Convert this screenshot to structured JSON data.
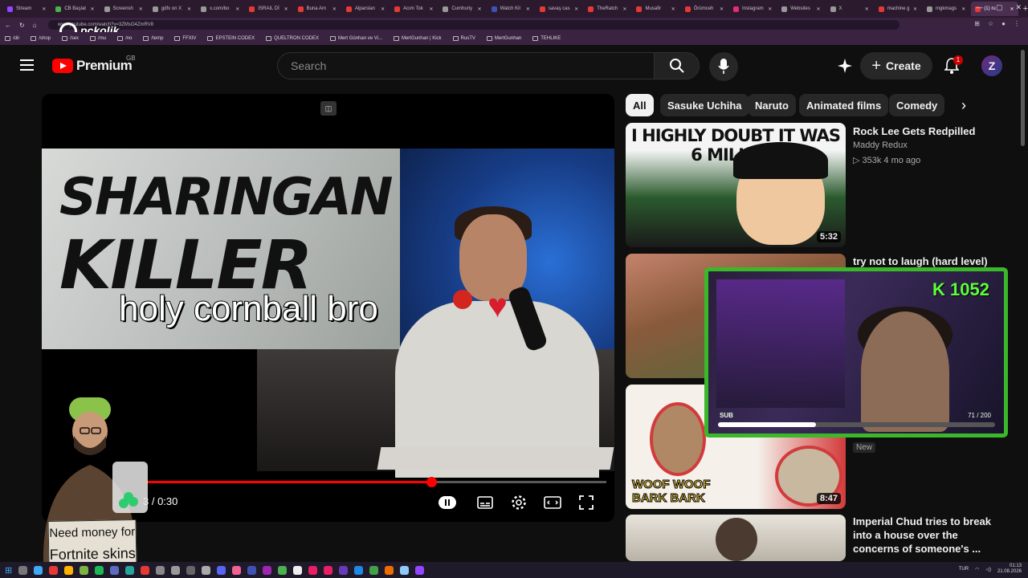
{
  "browser": {
    "tabs": [
      {
        "label": "Stream",
        "color": "#9146ff"
      },
      {
        "label": "CB Başlat",
        "color": "#4caf50"
      },
      {
        "label": "Screensh",
        "color": "#999999"
      },
      {
        "label": "gdfx on X",
        "color": "#999999"
      },
      {
        "label": "x.com/bo",
        "color": "#999999"
      },
      {
        "label": "ISRAIL Dİ",
        "color": "#e53935"
      },
      {
        "label": "Buna Am",
        "color": "#e53935"
      },
      {
        "label": "Alparslan",
        "color": "#e53935"
      },
      {
        "label": "Acım Tok",
        "color": "#e53935"
      },
      {
        "label": "Cumhuriy",
        "color": "#999999"
      },
      {
        "label": "Watch Kil",
        "color": "#3f51b5"
      },
      {
        "label": "savaş cas",
        "color": "#e53935"
      },
      {
        "label": "TheRatch",
        "color": "#e53935"
      },
      {
        "label": "Musafir",
        "color": "#e53935"
      },
      {
        "label": "Örümceh",
        "color": "#e53935"
      },
      {
        "label": "Instagram",
        "color": "#e1306c"
      },
      {
        "label": "Websites",
        "color": "#999999"
      },
      {
        "label": "X",
        "color": "#999999"
      },
      {
        "label": "machine g",
        "color": "#e53935"
      },
      {
        "label": "mgkmags",
        "color": "#999999"
      },
      {
        "label": "(1) ru",
        "color": "#e53935"
      }
    ],
    "active_tab_index": 20,
    "url": "www.youtube.com/watch?v=3ZMsO4ZmRV8",
    "bookmarks": [
      "/dir",
      "/shop",
      "/sex",
      "/mu",
      "/no",
      "/temp",
      "FFXIV",
      "EPSTEIN CODEX",
      "QUELTRON CODEX",
      "Mert Günhan ve Vi...",
      "MertGunhan | Kick",
      "RusTV",
      "MertGunhan",
      "TEHLIKE"
    ],
    "watermark": "pckolik"
  },
  "header": {
    "logo_text": "Premium",
    "region": "GB",
    "search_placeholder": "Search",
    "create_label": "Create",
    "notification_count": "1",
    "avatar_letter": "Z"
  },
  "player": {
    "thumbnail_text_line1": "SHARINGAN",
    "thumbnail_text_line2": "KILLER",
    "caption": "holy cornball bro",
    "time_display": "3 / 0:30",
    "progress": 0.62
  },
  "overlay": {
    "sign_text_line1": "Need money for",
    "sign_text_line2": "Fortnite skins",
    "kick_count": "K 1052",
    "sub_label": "SUB",
    "sub_count": "71 / 200",
    "sub_progress": 0.355,
    "accent": "#3ab82a"
  },
  "chips": [
    "All",
    "Sasuke Uchiha",
    "Naruto",
    "Animated films",
    "Comedy"
  ],
  "recommendations": [
    {
      "thumb_text": "I HIGHLY DOUBT IT WAS 6 MILLION",
      "title": "Rock Lee Gets Redpilled",
      "channel": "Maddy Redux",
      "meta": "▷ 353k  4 mo ago",
      "duration": "5:32"
    },
    {
      "title": "try not to laugh (hard level)"
    },
    {
      "thumb_text": "WOOF WOOF BARK BARK",
      "duration": "8:47",
      "badge": "New"
    },
    {
      "title_line1": "Imperial Chud tries to break",
      "title_line2": "into a house over the",
      "title_line3": "concerns of someone's ..."
    }
  ],
  "taskbar": {
    "lang": "TUR",
    "time": "01:13",
    "date": "21.08.2026"
  }
}
